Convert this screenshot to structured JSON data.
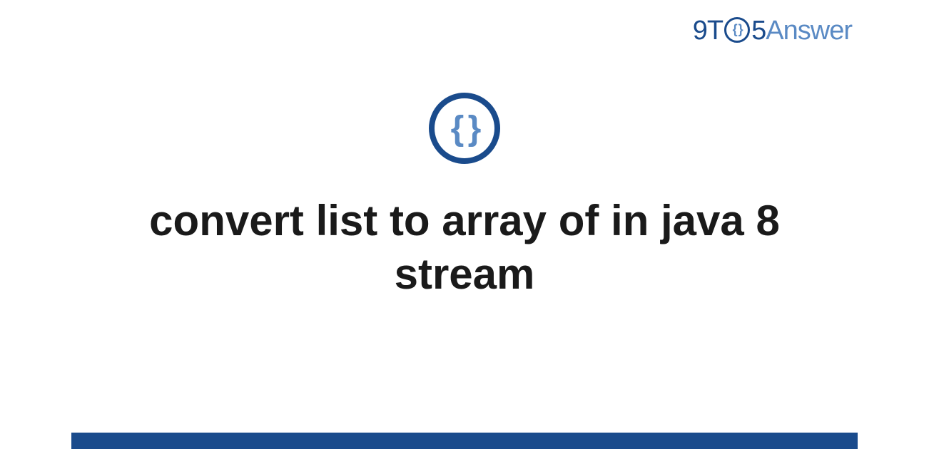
{
  "logo": {
    "part1": "9T",
    "braces": "{ }",
    "part2": "5",
    "part3": "Answer"
  },
  "center_icon": {
    "braces": "{ }"
  },
  "title": "convert list to array of in java 8 stream"
}
